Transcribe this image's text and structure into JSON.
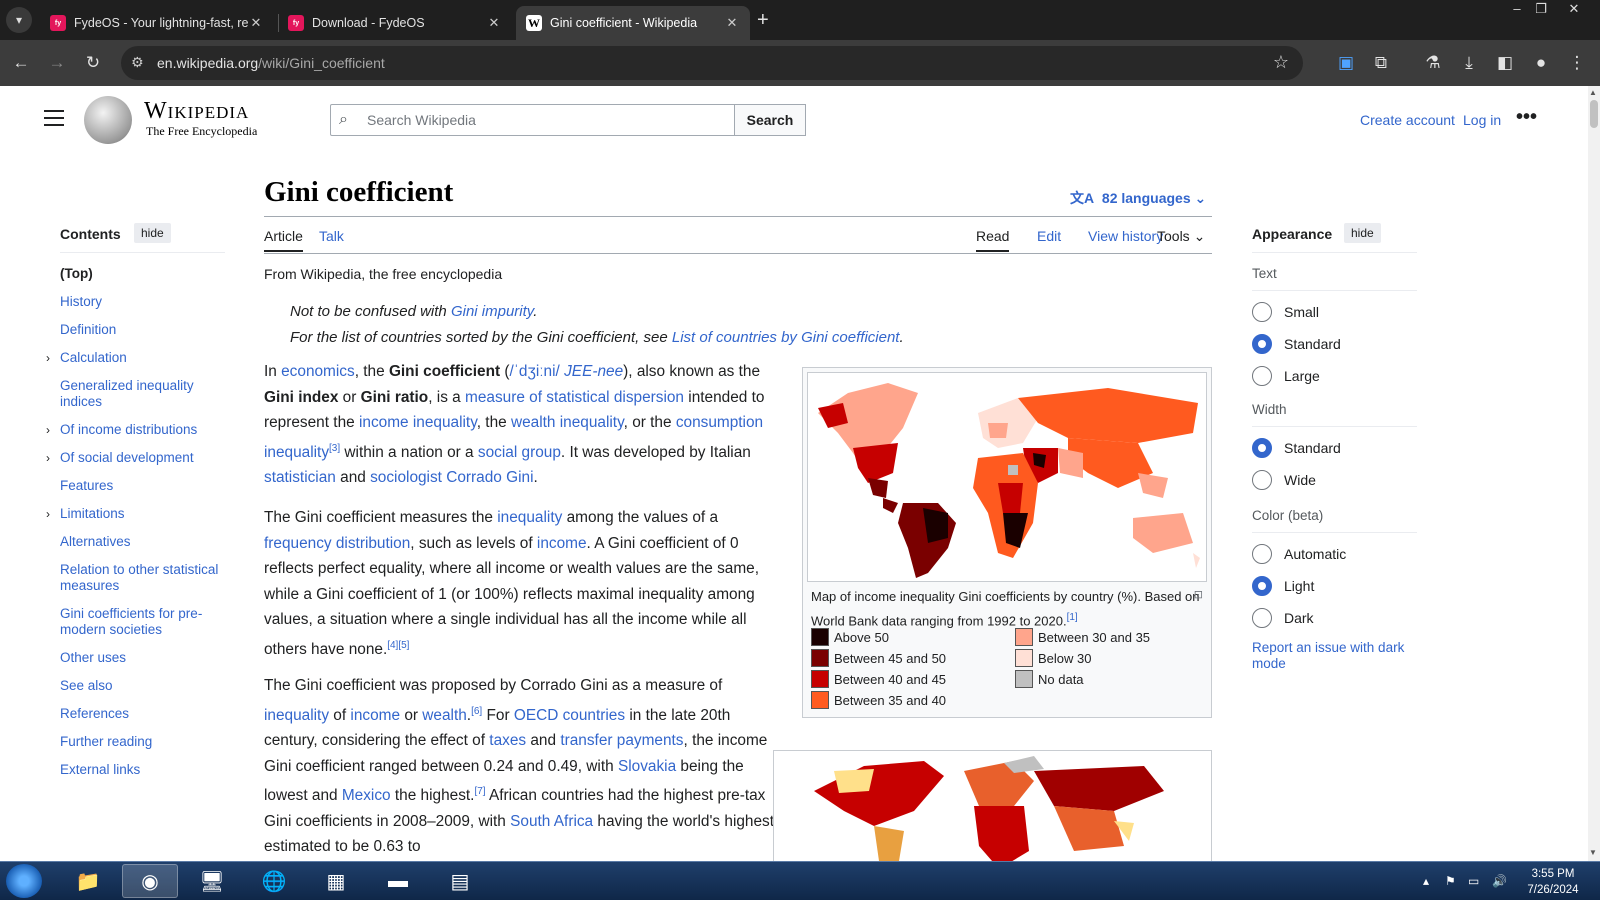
{
  "browser": {
    "tabs": [
      {
        "title": "FydeOS - Your lightning-fast, re",
        "favicon": "fydeos-icon",
        "active": false
      },
      {
        "title": "Download - FydeOS",
        "favicon": "fydeos-icon",
        "active": false
      },
      {
        "title": "Gini coefficient - Wikipedia",
        "favicon": "wikipedia-icon",
        "active": true
      }
    ],
    "url_host": "en.wikipedia.org",
    "url_path": "/wiki/Gini_coefficient"
  },
  "header": {
    "wordmark": "Wikipedia",
    "tagline": "The Free Encyclopedia",
    "search_placeholder": "Search Wikipedia",
    "search_button": "Search",
    "create_account": "Create account",
    "log_in": "Log in"
  },
  "page": {
    "title": "Gini coefficient",
    "languages": "82 languages",
    "tabs": {
      "article": "Article",
      "talk": "Talk",
      "read": "Read",
      "edit": "Edit",
      "history": "View history",
      "tools": "Tools"
    },
    "from": "From Wikipedia, the free encyclopedia",
    "hatnote1_prefix": "Not to be confused with ",
    "hatnote1_link": "Gini impurity",
    "hatnote1_suffix": ".",
    "hatnote2_prefix": "For the list of countries sorted by the Gini coefficient, see ",
    "hatnote2_link": "List of countries by Gini coefficient",
    "hatnote2_suffix": "."
  },
  "toc": {
    "heading": "Contents",
    "hide": "hide",
    "items": [
      {
        "label": "(Top)",
        "expandable": false
      },
      {
        "label": "History",
        "expandable": false
      },
      {
        "label": "Definition",
        "expandable": false
      },
      {
        "label": "Calculation",
        "expandable": true
      },
      {
        "label": "Generalized inequality indices",
        "expandable": false
      },
      {
        "label": "Of income distributions",
        "expandable": true
      },
      {
        "label": "Of social development",
        "expandable": true
      },
      {
        "label": "Features",
        "expandable": false
      },
      {
        "label": "Limitations",
        "expandable": true
      },
      {
        "label": "Alternatives",
        "expandable": false
      },
      {
        "label": "Relation to other statistical measures",
        "expandable": false
      },
      {
        "label": "Gini coefficients for pre-modern societies",
        "expandable": false
      },
      {
        "label": "Other uses",
        "expandable": false
      },
      {
        "label": "See also",
        "expandable": false
      },
      {
        "label": "References",
        "expandable": false
      },
      {
        "label": "Further reading",
        "expandable": false
      },
      {
        "label": "External links",
        "expandable": false
      }
    ]
  },
  "article": {
    "p1": {
      "t1": "In ",
      "l1": "economics",
      "t2": ", the ",
      "b1": "Gini coefficient",
      "t3": " (",
      "l2": "/ˈdʒiːni/",
      "l3": "JEE-nee",
      "t4": "), also known as the ",
      "b2": "Gini index",
      "t5": " or ",
      "b3": "Gini ratio",
      "t6": ", is a ",
      "l4": "measure of statistical dispersion",
      "t7": " intended to represent the ",
      "l5": "income inequality",
      "t8": ", the ",
      "l6": "wealth inequality",
      "t9": ", or the ",
      "l7": "consumption inequality",
      "s1": "[3]",
      "t10": " within a nation or a ",
      "l8": "social group",
      "t11": ". It was developed by Italian ",
      "l9": "statistician",
      "t12": " and ",
      "l10": "sociologist",
      "l11": "Corrado Gini",
      "t13": "."
    },
    "p2": {
      "t1": "The Gini coefficient measures the ",
      "l1": "inequality",
      "t2": " among the values of a ",
      "l2": "frequency distribution",
      "t3": ", such as levels of ",
      "l3": "income",
      "t4": ". A Gini coefficient of 0 reflects perfect equality, where all income or wealth values are the same, while a Gini coefficient of 1 (or 100%) reflects maximal inequality among values, a situation where a single individual has all the income while all others have none.",
      "s1": "[4][5]"
    },
    "p3": {
      "t1": "The Gini coefficient was proposed by Corrado Gini as a measure of ",
      "l1": "inequality",
      "t2": " of ",
      "l2": "income",
      "t3": " or ",
      "l3": "wealth",
      "t4": ".",
      "s1": "[6]",
      "t5": " For ",
      "l4": "OECD countries",
      "t6": " in the late 20th century, considering the effect of ",
      "l5": "taxes",
      "t7": " and ",
      "l6": "transfer payments",
      "t8": ", the income Gini coefficient ranged between 0.24 and 0.49, with ",
      "l7": "Slovakia",
      "t9": " being the lowest and ",
      "l8": "Mexico",
      "t10": " the highest.",
      "s2": "[7]",
      "t11": " African countries had the highest pre-tax Gini coefficients in 2008–2009, with ",
      "l9": "South Africa",
      "t12": " having the world's highest, estimated to be 0.63 to"
    }
  },
  "figure": {
    "caption": "Map of income inequality Gini coefficients by country (%). Based on World Bank data ranging from 1992 to 2020.",
    "caption_ref": "[1]",
    "legend": [
      {
        "label": "Above 50",
        "color": "#1a0000"
      },
      {
        "label": "Between 45 and 50",
        "color": "#7a0000"
      },
      {
        "label": "Between 40 and 45",
        "color": "#c60000"
      },
      {
        "label": "Between 35 and 40",
        "color": "#ff5a1f"
      },
      {
        "label": "Between 30 and 35",
        "color": "#ffa58c"
      },
      {
        "label": "Below 30",
        "color": "#ffe0d6"
      },
      {
        "label": "No data",
        "color": "#c0c0c0"
      }
    ]
  },
  "appearance": {
    "heading": "Appearance",
    "hide": "hide",
    "text_label": "Text",
    "text_options": [
      {
        "label": "Small",
        "on": false
      },
      {
        "label": "Standard",
        "on": true
      },
      {
        "label": "Large",
        "on": false
      }
    ],
    "width_label": "Width",
    "width_options": [
      {
        "label": "Standard",
        "on": true
      },
      {
        "label": "Wide",
        "on": false
      }
    ],
    "color_label": "Color (beta)",
    "color_options": [
      {
        "label": "Automatic",
        "on": false
      },
      {
        "label": "Light",
        "on": true
      },
      {
        "label": "Dark",
        "on": false
      }
    ],
    "report": "Report an issue with dark mode"
  },
  "taskbar": {
    "time": "3:55 PM",
    "date": "7/26/2024"
  },
  "colors": {
    "link": "#3366cc",
    "chrome_dark": "#1f1f1f",
    "toolbar": "#3c3c3c"
  }
}
